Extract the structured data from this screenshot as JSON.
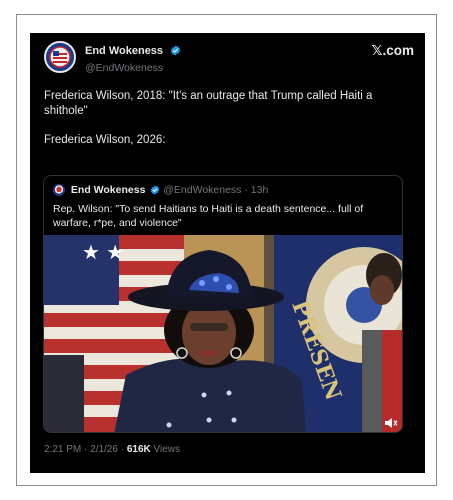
{
  "tweet": {
    "author_name": "End Wokeness",
    "author_handle": "@EndWokeness",
    "brand": "𝕏.com",
    "text_line_1": "Frederica Wilson, 2018: \"It's an outrage that Trump called Haiti a shithole\"",
    "text_line_2": "Frederica Wilson, 2026:",
    "timestamp": "2:21 PM · 2/1/26 · ",
    "views_count": "616K",
    "views_label": " Views"
  },
  "quote": {
    "author_name": "End Wokeness",
    "author_handle": "@EndWokeness",
    "time_ago": "· 13h",
    "text": "Rep. Wilson: \"To send Haitians to Haiti is a death sentence... full of warfare, r*pe, and violence\""
  },
  "icons": {
    "verified": "verified-badge-icon",
    "volume": "volume-icon"
  },
  "colors": {
    "background": "#000000",
    "text": "#e7e9ea",
    "muted": "#71767b",
    "verified": "#1d9bf0"
  }
}
